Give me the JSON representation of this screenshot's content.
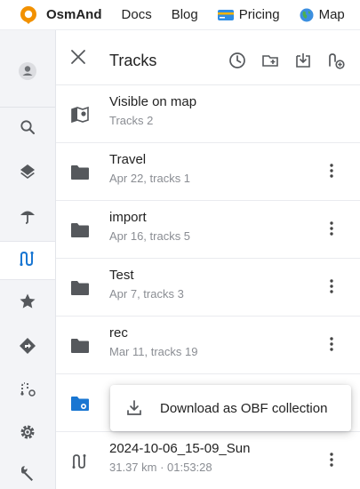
{
  "navbar": {
    "brand": "OsmAnd",
    "links": [
      "Docs",
      "Blog",
      "Pricing",
      "Map"
    ],
    "brand_color": "#f29100"
  },
  "rail": {
    "items": [
      "account",
      "search",
      "layers",
      "weather",
      "tracks",
      "favorites",
      "navigation",
      "plan-route",
      "settings",
      "tools"
    ],
    "active": "tracks",
    "accent": "#1976d2"
  },
  "panel": {
    "title": "Tracks",
    "header_actions": [
      "history",
      "new-folder",
      "import",
      "create-track"
    ],
    "rows": [
      {
        "title": "Visible on map",
        "subtitle": "Tracks 2",
        "icon": "map-visible-icon"
      },
      {
        "title": "Travel",
        "subtitle": "Apr 22, tracks 1",
        "icon": "folder-icon"
      },
      {
        "title": "import",
        "subtitle": "Apr 16, tracks 5",
        "icon": "folder-icon"
      },
      {
        "title": "Test",
        "subtitle": "Apr 7, tracks 3",
        "icon": "folder-icon"
      },
      {
        "title": "rec",
        "subtitle": "Mar 11, tracks 19",
        "icon": "folder-icon"
      },
      {
        "title": "",
        "subtitle": "",
        "icon": "smart-folder-icon"
      },
      {
        "title": "2024-10-06_15-09_Sun",
        "subtitle": "31.37 km · 01:53:28",
        "icon": "track-icon"
      }
    ]
  },
  "popup": {
    "label": "Download as OBF collection"
  }
}
